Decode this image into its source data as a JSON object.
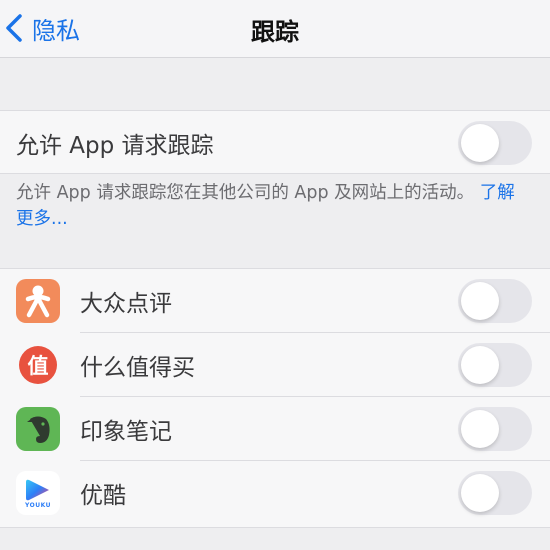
{
  "nav": {
    "back_label": "隐私",
    "title": "跟踪"
  },
  "allow_tracking": {
    "label": "允许 App 请求跟踪",
    "enabled": false
  },
  "footer": {
    "text": "允许 App 请求跟踪您在其他公司的 App 及网站上的活动。",
    "link": "了解更多..."
  },
  "apps": [
    {
      "name": "大众点评",
      "icon": "dianping-icon",
      "color": "#f28b5b",
      "enabled": false
    },
    {
      "name": "什么值得买",
      "icon": "smzdm-icon",
      "color": "#e8523f",
      "enabled": false,
      "icon_text": "值"
    },
    {
      "name": "印象笔记",
      "icon": "evernote-icon",
      "color": "#5fb655",
      "enabled": false
    },
    {
      "name": "优酷",
      "icon": "youku-icon",
      "color": "#2e7ff7",
      "enabled": false,
      "icon_text": "YOUKU"
    }
  ],
  "colors": {
    "accent": "#1a73e8",
    "toggle_off": "#e5e5ea"
  }
}
